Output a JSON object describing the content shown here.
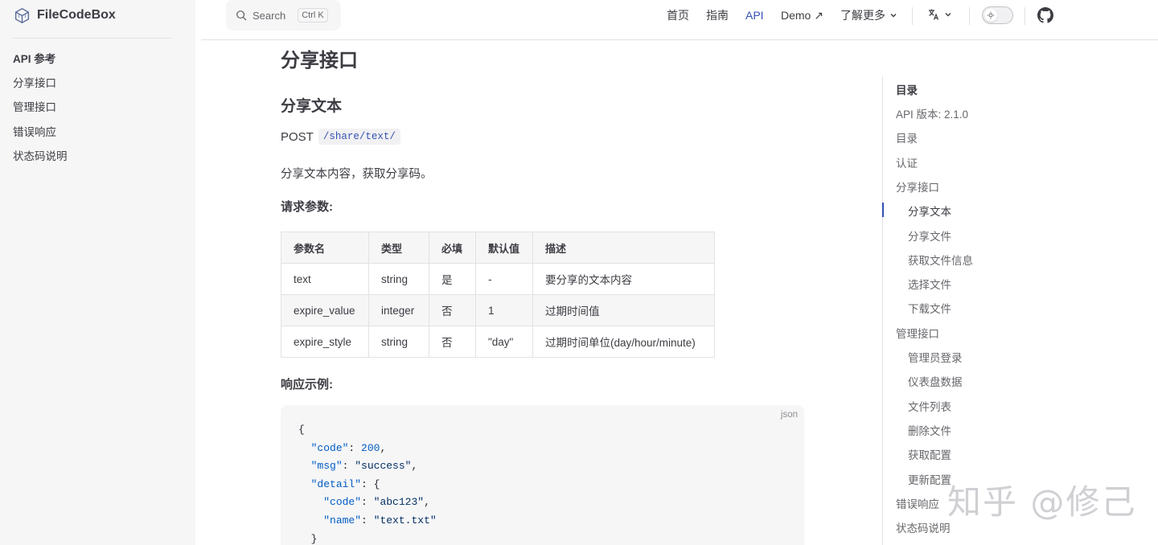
{
  "app": {
    "name": "FileCodeBox"
  },
  "sidebar": {
    "group_title": "API 参考",
    "items": [
      {
        "label": "分享接口"
      },
      {
        "label": "管理接口"
      },
      {
        "label": "错误响应"
      },
      {
        "label": "状态码说明"
      }
    ]
  },
  "topnav": {
    "search_label": "Search",
    "search_shortcut": "Ctrl K",
    "links": [
      {
        "label": "首页"
      },
      {
        "label": "指南"
      },
      {
        "label": "API"
      },
      {
        "label": "Demo ↗"
      },
      {
        "label": "了解更多"
      }
    ],
    "active_link": "API",
    "accent_color": "#3451b2"
  },
  "content": {
    "h1": "分享接口",
    "h2": "分享文本",
    "method": "POST",
    "path": "/share/text/",
    "description": "分享文本内容，获取分享码。",
    "params_heading": "请求参数:",
    "params_table": {
      "headers": [
        "参数名",
        "类型",
        "必填",
        "默认值",
        "描述"
      ],
      "rows": [
        [
          "text",
          "string",
          "是",
          "-",
          "要分享的文本内容"
        ],
        [
          "expire_value",
          "integer",
          "否",
          "1",
          "过期时间值"
        ],
        [
          "expire_style",
          "string",
          "否",
          "\"day\"",
          "过期时间单位(day/hour/minute)"
        ]
      ]
    },
    "response_heading": "响应示例:",
    "code_lang": "json",
    "code_lines": [
      "{",
      "  \"code\": 200,",
      "  \"msg\": \"success\",",
      "  \"detail\": {",
      "    \"code\": \"abc123\",",
      "    \"name\": \"text.txt\"",
      "  }"
    ]
  },
  "toc": {
    "title": "目录",
    "items": [
      {
        "label": "API 版本: 2.1.0",
        "level": 1
      },
      {
        "label": "目录",
        "level": 1
      },
      {
        "label": "认证",
        "level": 1
      },
      {
        "label": "分享接口",
        "level": 1
      },
      {
        "label": "分享文本",
        "level": 2,
        "active": true
      },
      {
        "label": "分享文件",
        "level": 2
      },
      {
        "label": "获取文件信息",
        "level": 2
      },
      {
        "label": "选择文件",
        "level": 2
      },
      {
        "label": "下载文件",
        "level": 2
      },
      {
        "label": "管理接口",
        "level": 1
      },
      {
        "label": "管理员登录",
        "level": 2
      },
      {
        "label": "仪表盘数据",
        "level": 2
      },
      {
        "label": "文件列表",
        "level": 2
      },
      {
        "label": "删除文件",
        "level": 2
      },
      {
        "label": "获取配置",
        "level": 2
      },
      {
        "label": "更新配置",
        "level": 2
      },
      {
        "label": "错误响应",
        "level": 1
      },
      {
        "label": "状态码说明",
        "level": 1
      }
    ]
  },
  "watermark": "知乎 @修己"
}
